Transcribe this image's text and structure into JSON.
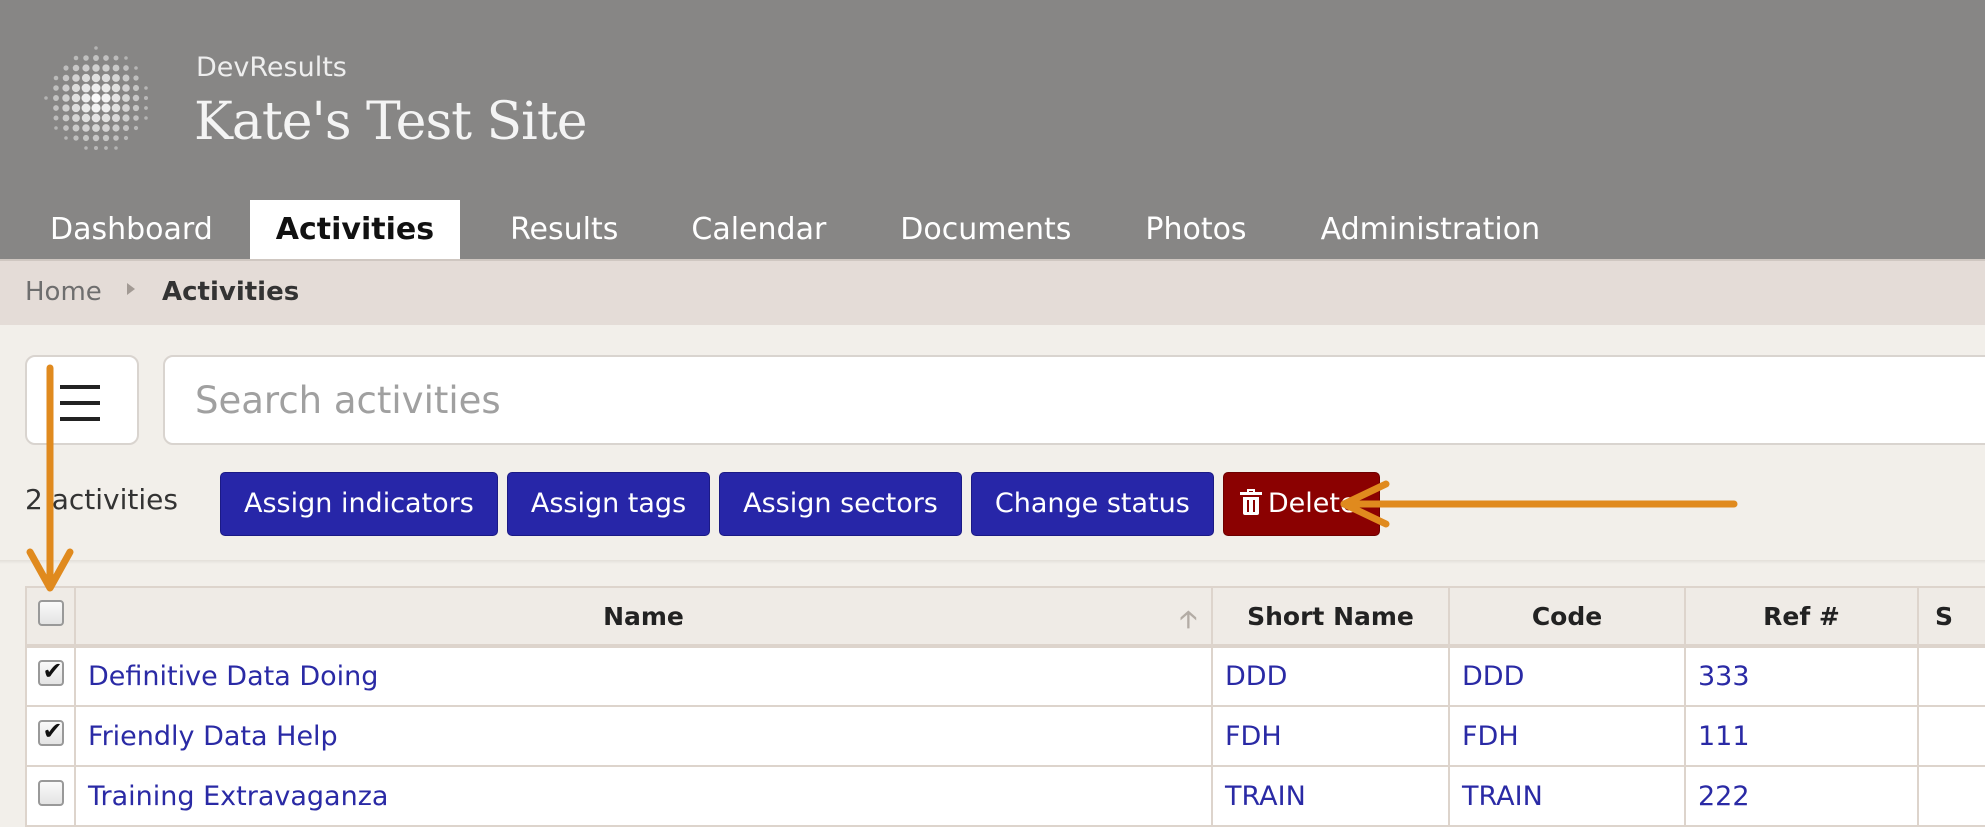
{
  "header": {
    "org_name": "DevResults",
    "site_title": "Kate's Test Site",
    "nav": [
      {
        "label": "Dashboard",
        "active": false
      },
      {
        "label": "Activities",
        "active": true
      },
      {
        "label": "Results",
        "active": false
      },
      {
        "label": "Calendar",
        "active": false
      },
      {
        "label": "Documents",
        "active": false
      },
      {
        "label": "Photos",
        "active": false
      },
      {
        "label": "Administration",
        "active": false
      }
    ]
  },
  "breadcrumb": {
    "home": "Home",
    "current": "Activities"
  },
  "toolbar": {
    "search_placeholder": "Search activities",
    "count_label": "2 activities",
    "actions": {
      "assign_indicators": "Assign indicators",
      "assign_tags": "Assign tags",
      "assign_sectors": "Assign sectors",
      "change_status": "Change status",
      "delete": "Delete"
    }
  },
  "table": {
    "columns": [
      "Name",
      "Short Name",
      "Code",
      "Ref #",
      "S"
    ],
    "rows": [
      {
        "checked": true,
        "name": "Definitive Data Doing",
        "short_name": "DDD",
        "code": "DDD",
        "ref": "333"
      },
      {
        "checked": true,
        "name": "Friendly Data Help",
        "short_name": "FDH",
        "code": "FDH",
        "ref": "111"
      },
      {
        "checked": false,
        "name": "Training Extravaganza",
        "short_name": "TRAIN",
        "code": "TRAIN",
        "ref": "222"
      }
    ]
  },
  "colors": {
    "header_bg": "#878685",
    "primary_button": "#2726a8",
    "danger_button": "#8b0101",
    "link": "#2a2aa5",
    "annotation_arrow": "#e08a1e"
  },
  "icons": {
    "menu": "hamburger-icon",
    "delete": "trash-icon",
    "sort": "sort-ascending-icon",
    "logo": "globe-dots-logo"
  }
}
